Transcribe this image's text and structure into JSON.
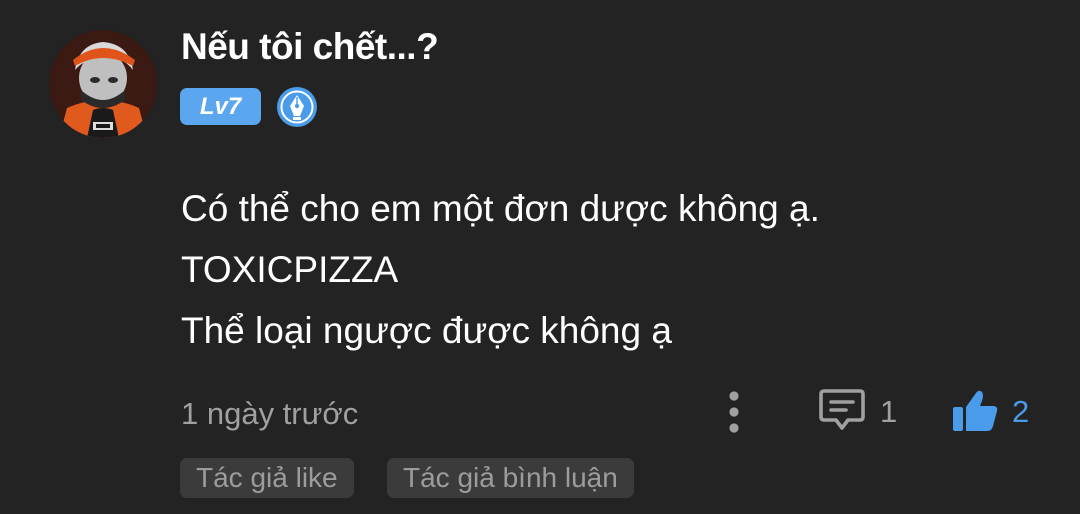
{
  "comment": {
    "user": {
      "name": "Nếu tôi chết...?",
      "level": "Lv7",
      "avatar_icon": "user-avatar",
      "author_badge_icon": "pen-badge-icon"
    },
    "lines": [
      "Có thể cho em một đơn dược không ạ.",
      "TOXICPIZZA",
      "Thể loại ngược được không ạ"
    ],
    "time": "1 ngày trước",
    "actions": {
      "more_icon": "more-vertical-icon",
      "reply_icon": "comment-icon",
      "reply_count": "1",
      "like_icon": "thumbs-up-icon",
      "like_count": "2"
    },
    "tags": [
      "Tác giả like",
      "Tác giả bình luận"
    ]
  },
  "colors": {
    "background": "#232323",
    "level_badge": "#5aa6ef",
    "like_blue": "#4a9bea",
    "muted_text": "#a0a0a0",
    "tag_background": "#3b3b3b"
  }
}
